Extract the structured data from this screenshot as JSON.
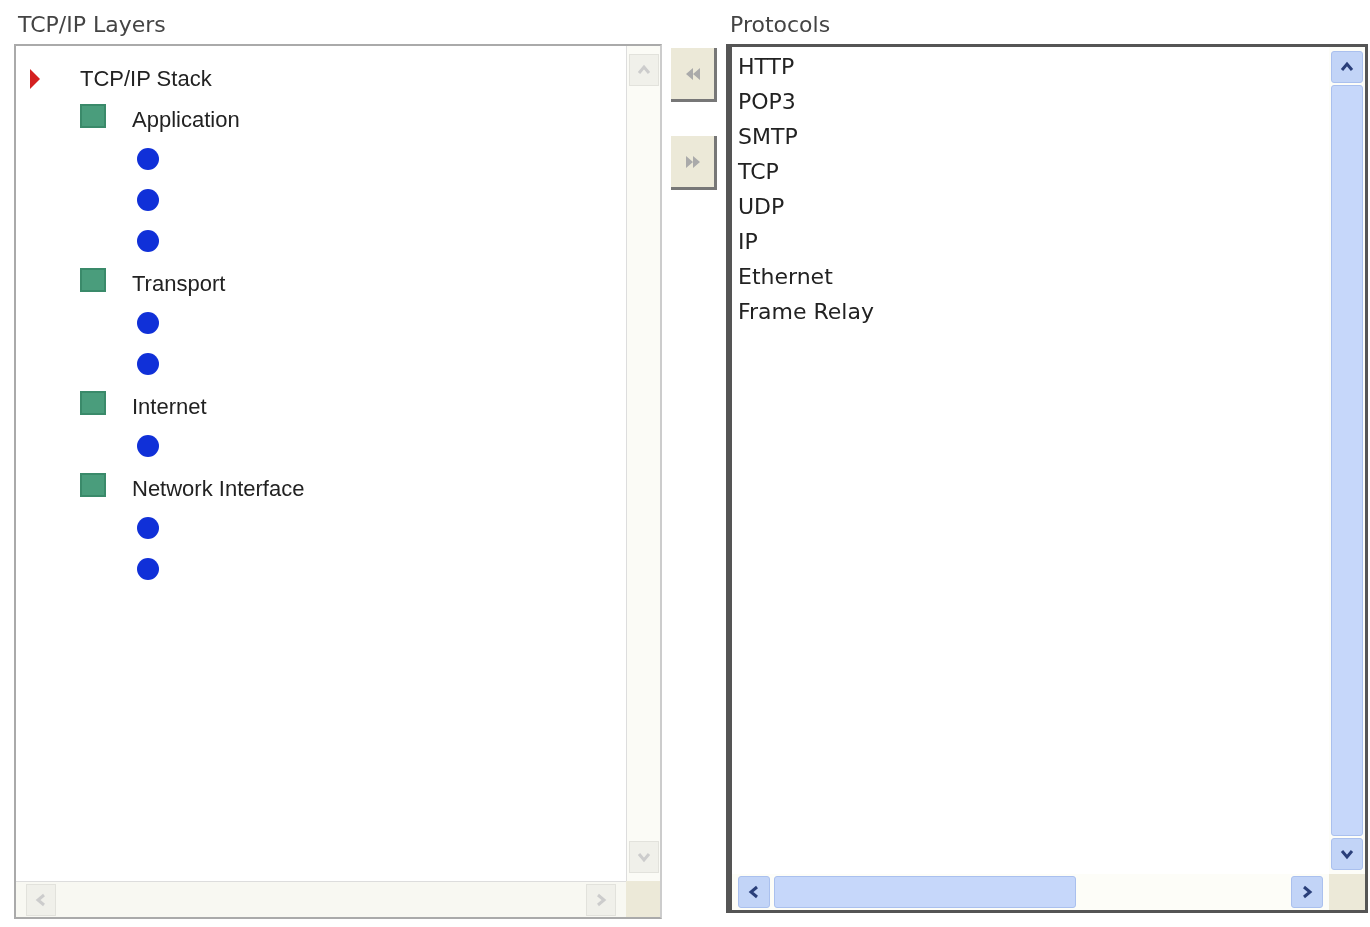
{
  "layers_panel": {
    "title": "TCP/IP Layers",
    "tree": [
      {
        "label": "TCP/IP Stack",
        "kind": "root",
        "expanded": true,
        "children": [
          {
            "label": "Application",
            "kind": "layer",
            "children": [
              {
                "kind": "slot"
              },
              {
                "kind": "slot"
              },
              {
                "kind": "slot"
              }
            ]
          },
          {
            "label": "Transport",
            "kind": "layer",
            "children": [
              {
                "kind": "slot"
              },
              {
                "kind": "slot"
              }
            ]
          },
          {
            "label": "Internet",
            "kind": "layer",
            "children": [
              {
                "kind": "slot"
              }
            ]
          },
          {
            "label": "Network Interface",
            "kind": "layer",
            "children": [
              {
                "kind": "slot"
              },
              {
                "kind": "slot"
              }
            ]
          }
        ]
      }
    ]
  },
  "move_buttons": [
    {
      "kind": "left",
      "disabled": true
    },
    {
      "kind": "right",
      "disabled": true
    }
  ],
  "protocols_panel": {
    "title": "Protocols",
    "items": [
      "HTTP",
      "POP3",
      "SMTP",
      "TCP",
      "UDP",
      "IP",
      "Ethernet",
      "Frame Relay"
    ]
  }
}
